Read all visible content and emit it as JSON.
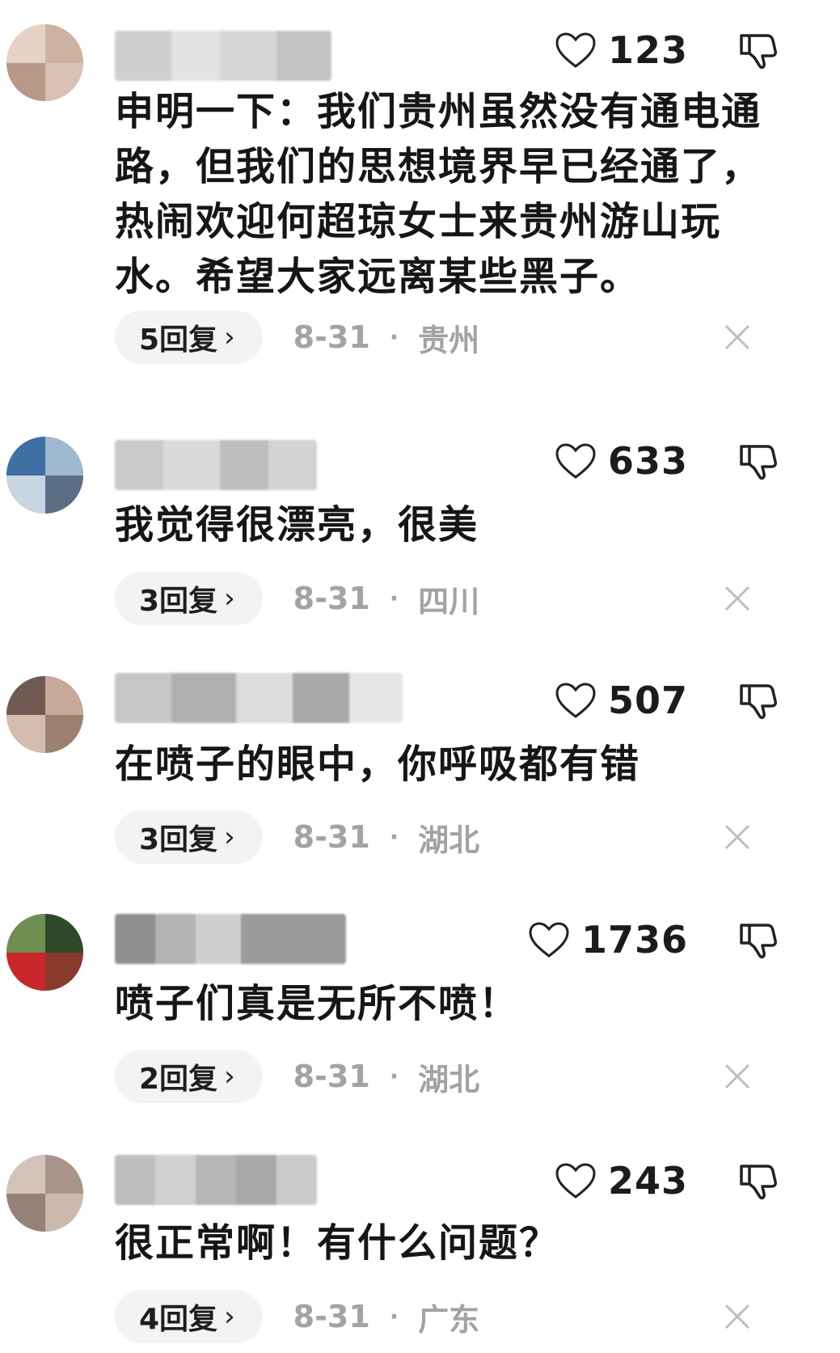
{
  "colors": {
    "text": "#161616",
    "meta_gray": "#a3a3a3",
    "pill_bg": "#f3f3f3",
    "icon": "#222222"
  },
  "comments": [
    {
      "likes": "123",
      "text": "申明一下：我们贵州虽然没有通电通路，但我们的思想境界早已经通了，热闹欢迎何超琼女士来贵州游山玩水。希望大家远离某些黑子。",
      "replies": "5回复",
      "date": "8-31",
      "location": "贵州"
    },
    {
      "likes": "633",
      "text": "我觉得很漂亮，很美",
      "replies": "3回复",
      "date": "8-31",
      "location": "四川"
    },
    {
      "likes": "507",
      "text": "在喷子的眼中，你呼吸都有错",
      "replies": "3回复",
      "date": "8-31",
      "location": "湖北"
    },
    {
      "likes": "1736",
      "text": "喷子们真是无所不喷！",
      "replies": "2回复",
      "date": "8-31",
      "location": "湖北"
    },
    {
      "likes": "243",
      "text": "很正常啊！有什么问题？",
      "replies": "4回复",
      "date": "8-31",
      "location": "广东"
    }
  ],
  "icons": {
    "like": "heart-outline-icon",
    "dislike": "thumbs-down-icon",
    "close": "close-icon",
    "replies_arrow": "chevron-right-icon"
  },
  "separator": "·",
  "chevron": "›"
}
